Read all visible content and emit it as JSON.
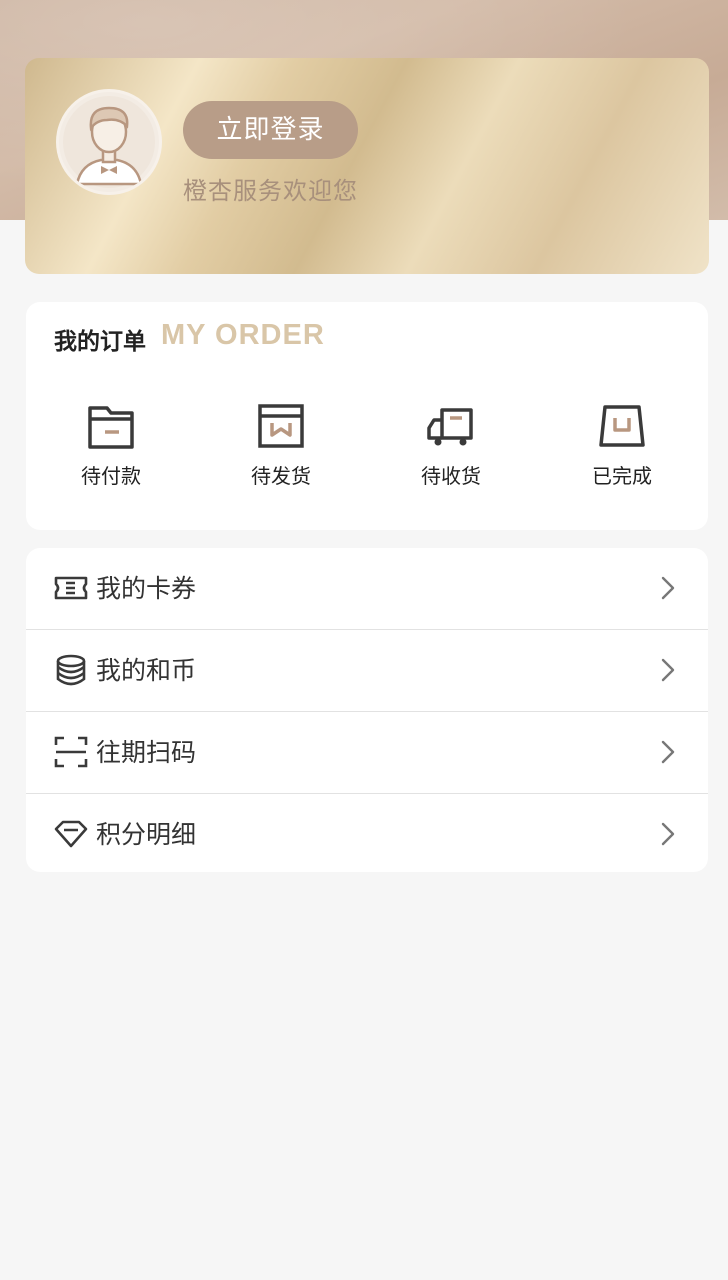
{
  "header": {
    "avatar_icon": "user-avatar-icon",
    "login_label": "立即登录",
    "welcome_text": "橙杏服务欢迎您"
  },
  "orders": {
    "title": "我的订单",
    "subtitle": "MY ORDER",
    "items": [
      {
        "label": "待付款",
        "icon": "wallet-icon"
      },
      {
        "label": "待发货",
        "icon": "package-icon"
      },
      {
        "label": "待收货",
        "icon": "truck-icon"
      },
      {
        "label": "已完成",
        "icon": "bag-icon"
      }
    ]
  },
  "menu": {
    "items": [
      {
        "label": "我的卡券",
        "icon": "ticket-icon"
      },
      {
        "label": "我的和币",
        "icon": "coins-icon"
      },
      {
        "label": "往期扫码",
        "icon": "scan-icon"
      },
      {
        "label": "积分明细",
        "icon": "diamond-icon"
      }
    ]
  },
  "colors": {
    "accent": "#b89d88",
    "gold": "#d9c6a8",
    "icon_accent": "#b89780",
    "icon_dark": "#3a3a3a"
  }
}
